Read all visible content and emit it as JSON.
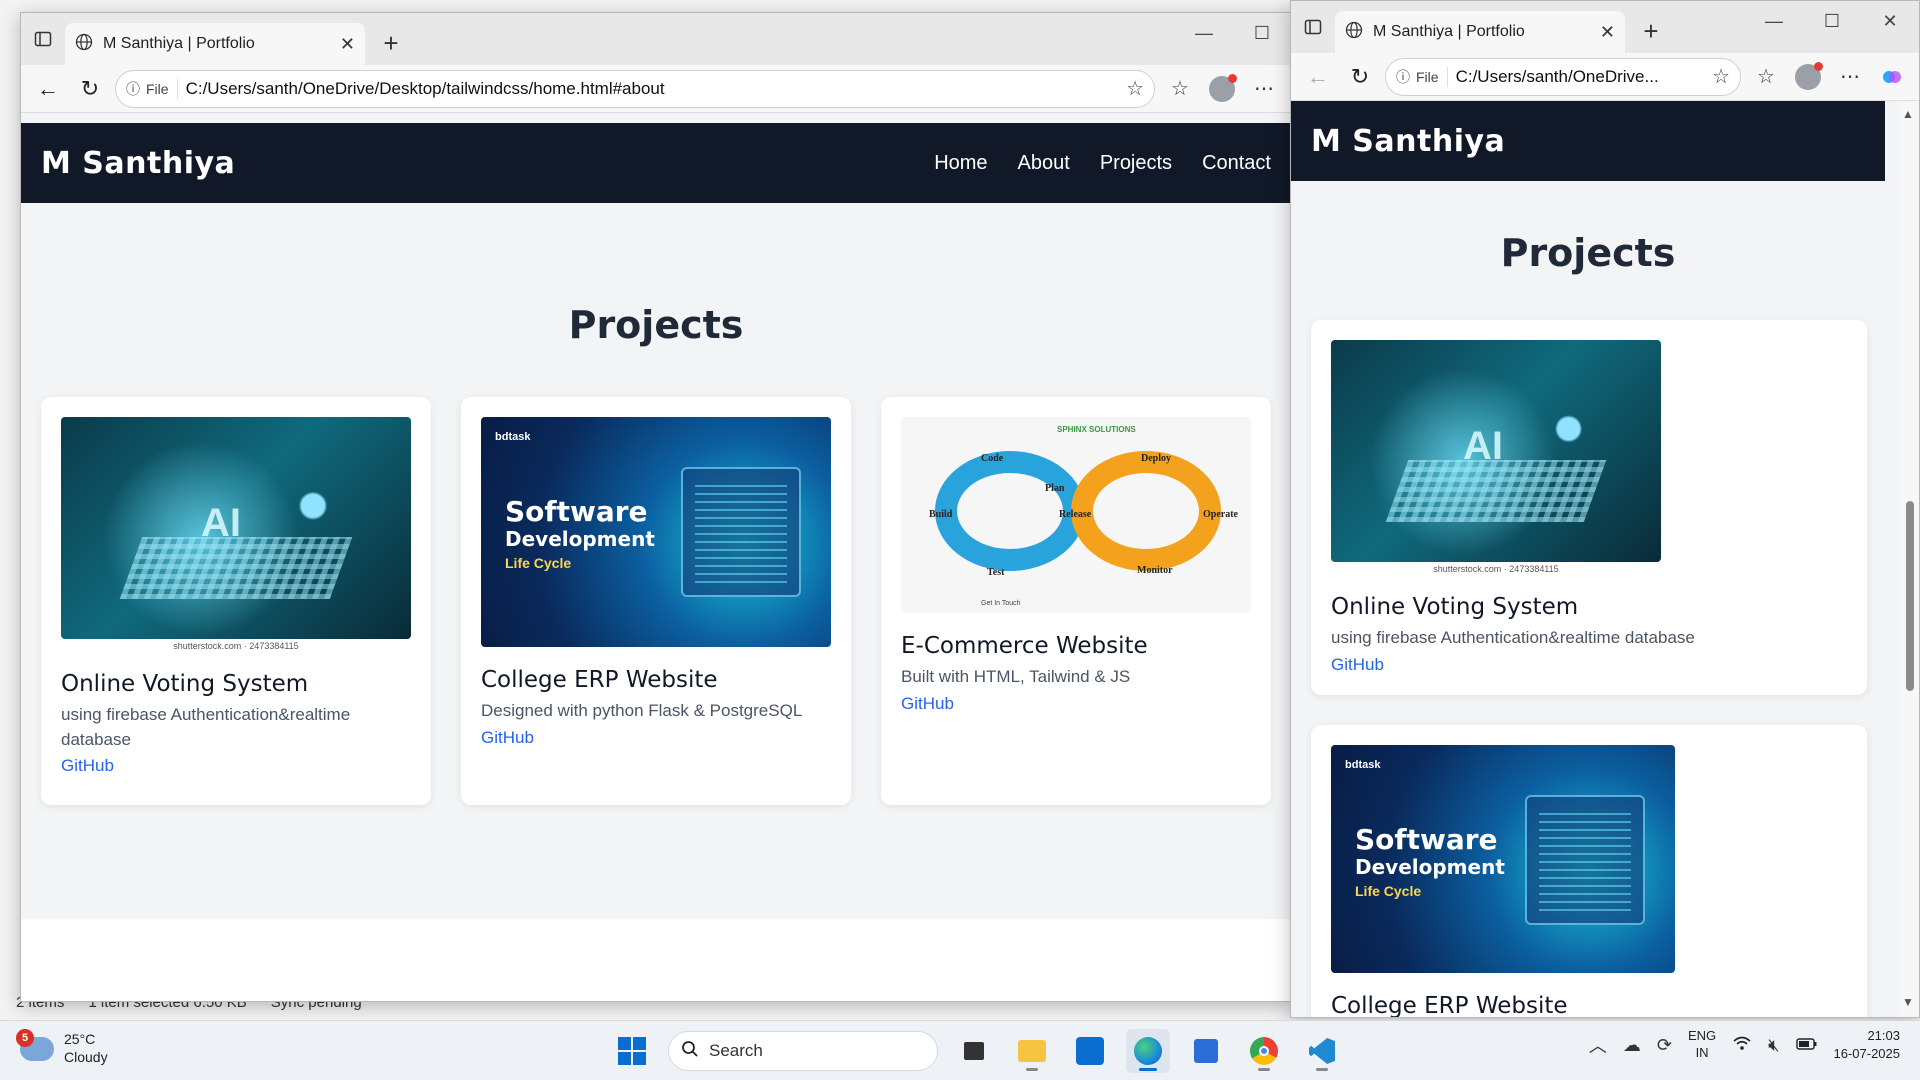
{
  "explorer_status": {
    "items": "2 items",
    "selected": "1 item selected  6.50 KB",
    "sync": "Sync pending"
  },
  "left_browser": {
    "tab_title": "M Santhiya | Portfolio",
    "file_label": "File",
    "url": "C:/Users/santh/OneDrive/Desktop/tailwindcss/home.html#about",
    "site": {
      "brand": "M Santhiya",
      "nav": [
        "Home",
        "About",
        "Projects",
        "Contact"
      ],
      "section_title": "Projects",
      "projects": [
        {
          "title": "Online Voting System",
          "desc": "using firebase Authentication&realtime database",
          "link": "GitHub",
          "caption": "shutterstock.com · 2473384115"
        },
        {
          "title": "College ERP Website",
          "desc": "Designed with python Flask & PostgreSQL",
          "link": "GitHub",
          "img_brand": "bdtask",
          "img_line1": "Software",
          "img_line2": "Development",
          "img_line3": "Life Cycle"
        },
        {
          "title": "E-Commerce Website",
          "desc": "Built with HTML, Tailwind & JS",
          "link": "GitHub",
          "img_brand": "SPHINX SOLUTIONS",
          "img_labels": [
            "Code",
            "Plan",
            "Build",
            "Test",
            "Release",
            "Deploy",
            "Operate",
            "Monitor"
          ],
          "img_footer": "Get In Touch"
        }
      ]
    }
  },
  "right_browser": {
    "tab_title": "M Santhiya | Portfolio",
    "file_label": "File",
    "url": "C:/Users/santh/OneDrive...",
    "site": {
      "brand": "M Santhiya",
      "section_title": "Projects",
      "projects": [
        {
          "title": "Online Voting System",
          "desc": "using firebase Authentication&realtime database",
          "link": "GitHub",
          "caption": "shutterstock.com · 2473384115"
        },
        {
          "title": "College ERP Website",
          "img_brand": "bdtask",
          "img_line1": "Software",
          "img_line2": "Development",
          "img_line3": "Life Cycle"
        }
      ]
    }
  },
  "taskbar": {
    "weather_badge": "5",
    "weather_temp": "25°C",
    "weather_desc": "Cloudy",
    "search_placeholder": "Search",
    "lang_line1": "ENG",
    "lang_line2": "IN",
    "time": "21:03",
    "date": "16-07-2025",
    "apps": [
      "task-view",
      "file-explorer",
      "myhp",
      "edge",
      "store",
      "chrome",
      "vscode"
    ]
  },
  "colors": {
    "nav_bg": "#111827",
    "link": "#2563eb",
    "page_bg": "#f3f4f6"
  }
}
